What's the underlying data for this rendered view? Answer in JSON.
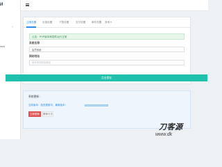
{
  "sidebar": {
    "brand": "И",
    "submenu_arrow": "‹",
    "item_label": "med"
  },
  "topbar": {
    "menu_icon": "hamburger-icon"
  },
  "tabs": [
    {
      "label": "注册设置",
      "active": true
    },
    {
      "label": "优惠设置",
      "active": false
    },
    {
      "label": "下载设置",
      "active": false
    },
    {
      "label": "支付设置",
      "active": false
    },
    {
      "label": "邮件设置",
      "active": false
    },
    {
      "label": "其他 ▾",
      "active": false
    }
  ],
  "notice": {
    "text": "公告：PHP版本和插件运行正常"
  },
  "form": {
    "field1_label": "系统名称",
    "field1_value": "会员系统",
    "field2_label": "网站地址",
    "field2_placeholder": "填写你的网站域名",
    "submit_label": "点击保存"
  },
  "update_card": {
    "title": "系统更新：",
    "status": "当前版本：检查更新中，最新版本：",
    "primary_button": "立即更新",
    "secondary_button": "更新日志"
  },
  "watermark": {
    "text": "刀客源",
    "sub": "www.dk"
  }
}
